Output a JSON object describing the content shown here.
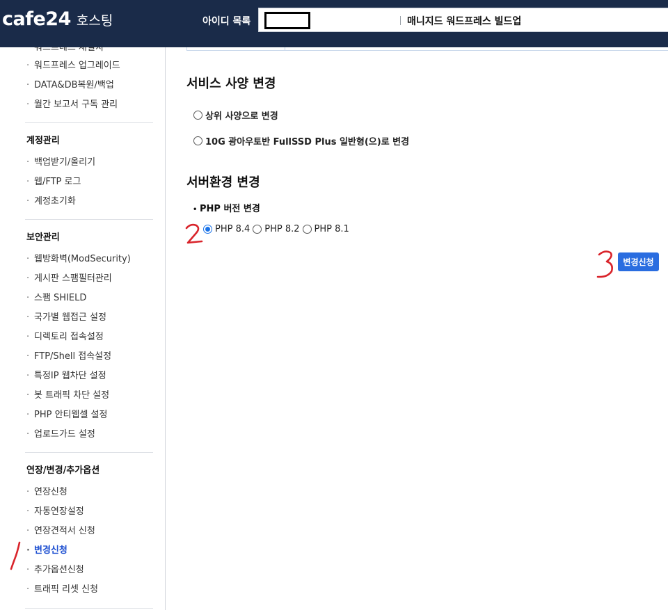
{
  "header": {
    "logo": "cafe24",
    "logo_sub": "호스팅",
    "account_label": "아이디 목록",
    "account_product": "매니지드 워드프레스 빌드업"
  },
  "sidebar": {
    "top_items": [
      "워드프레스 재설치",
      "워드프레스 업그레이드",
      "DATA&DB복원/백업",
      "월간 보고서 구독 관리"
    ],
    "groups": [
      {
        "title": "계정관리",
        "items": [
          "백업받기/올리기",
          "웹/FTP 로그",
          "계정초기화"
        ]
      },
      {
        "title": "보안관리",
        "items": [
          "웹방화벽(ModSecurity)",
          "게시판 스팸필터관리",
          "스팸 SHIELD",
          "국가별 웹접근 설정",
          "디렉토리 접속설정",
          "FTP/Shell 접속설정",
          "특정IP 웹차단 설정",
          "봇 트래픽 차단 설정",
          "PHP 안티웹셀 설정",
          "업로드가드 설정"
        ]
      },
      {
        "title": "연장/변경/추가옵션",
        "items": [
          "연장신청",
          "자동연장설정",
          "연장견적서 신청",
          "변경신청",
          "추가옵션신청",
          "트래픽 리셋 신청"
        ],
        "active_index": 3
      }
    ]
  },
  "main": {
    "spec_title": "서비스 사양 변경",
    "spec_options": [
      "상위 사양으로 변경",
      "10G 광아우토반 FullSSD Plus 일반형(으)로 변경"
    ],
    "env_title": "서버환경 변경",
    "php_label": "PHP 버전 변경",
    "php_options": [
      "PHP 8.4",
      "PHP 8.2",
      "PHP 8.1"
    ],
    "php_selected": "PHP 8.4",
    "submit_label": "변경신청"
  },
  "annotations": {
    "step1": "1",
    "step2": "2",
    "step3": "3",
    "color": "#d9242b"
  },
  "colors": {
    "header_bg": "#1a2b49",
    "accent": "#2a6de0",
    "active_link": "#1d4fd1"
  }
}
